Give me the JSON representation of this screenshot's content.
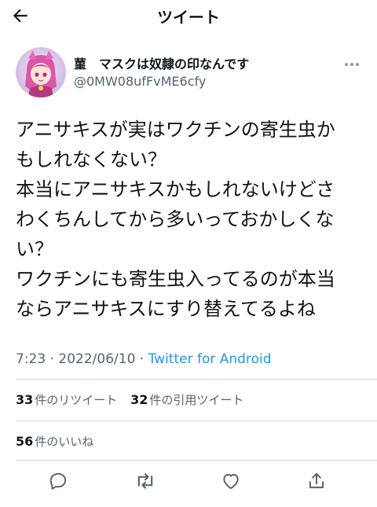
{
  "header": {
    "title": "ツイート",
    "back_icon": "back-arrow-icon"
  },
  "tweet": {
    "display_name": "菫　マスクは奴隷の印なんです",
    "handle": "@0MW08ufFvME6cfy",
    "lines": [
      "アニサキスが実はワクチンの寄生虫か",
      "もしれなくない？",
      "本当にアニサキスかもしれないけどさ",
      "わくちんしてから多いっておかしくな",
      "い？",
      "ワクチンにも寄生虫入ってるのが本当",
      "ならアニサキスにすり替えてるよね"
    ],
    "time": "7:23",
    "date": "2022/06/10",
    "separator": "·",
    "source": "Twitter for Android"
  },
  "stats": {
    "retweets_count": "33",
    "retweets_label": "件のリツイート",
    "quotes_count": "32",
    "quotes_label": "件の引用ツイート",
    "likes_count": "56",
    "likes_label": "件のいいね"
  },
  "actions": {
    "reply_icon": "reply-icon",
    "retweet_icon": "retweet-icon",
    "like_icon": "heart-icon",
    "share_icon": "share-icon"
  },
  "colors": {
    "link_blue": "#1d9bf0",
    "muted": "#536471",
    "text": "#0f1419"
  }
}
